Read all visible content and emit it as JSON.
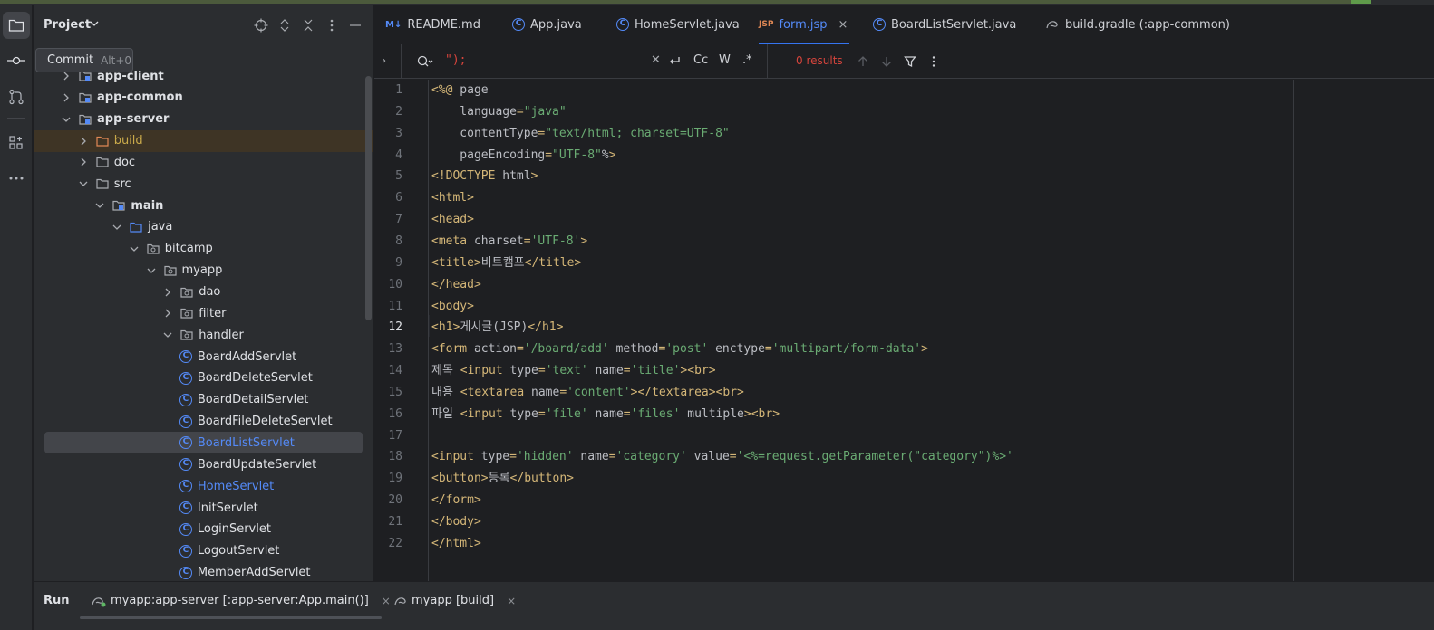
{
  "colors": {
    "accent": "#3574f0",
    "tag": "#d5b778",
    "string": "#6aab73",
    "search_no_results": "#d5443c",
    "class_icon": "#548af7"
  },
  "project_panel": {
    "title": "Project",
    "tooltip": {
      "label": "Commit",
      "shortcut": "Alt+0"
    },
    "tree": [
      {
        "label": "app-client",
        "depth": 1,
        "type": "module",
        "expanded": false
      },
      {
        "label": "app-common",
        "depth": 1,
        "type": "module",
        "expanded": false
      },
      {
        "label": "app-server",
        "depth": 1,
        "type": "module",
        "expanded": true
      },
      {
        "label": "build",
        "depth": 2,
        "type": "folder-excluded",
        "expanded": false
      },
      {
        "label": "doc",
        "depth": 2,
        "type": "folder",
        "expanded": false
      },
      {
        "label": "src",
        "depth": 2,
        "type": "folder",
        "expanded": true
      },
      {
        "label": "main",
        "depth": 3,
        "type": "folder-source",
        "expanded": true
      },
      {
        "label": "java",
        "depth": 4,
        "type": "folder-java",
        "expanded": true
      },
      {
        "label": "bitcamp",
        "depth": 5,
        "type": "package",
        "expanded": true
      },
      {
        "label": "myapp",
        "depth": 6,
        "type": "package",
        "expanded": true
      },
      {
        "label": "dao",
        "depth": 7,
        "type": "package",
        "expanded": false
      },
      {
        "label": "filter",
        "depth": 7,
        "type": "package",
        "expanded": false
      },
      {
        "label": "handler",
        "depth": 7,
        "type": "package",
        "expanded": true
      },
      {
        "label": "BoardAddServlet",
        "depth": 8,
        "type": "class"
      },
      {
        "label": "BoardDeleteServlet",
        "depth": 8,
        "type": "class"
      },
      {
        "label": "BoardDetailServlet",
        "depth": 8,
        "type": "class"
      },
      {
        "label": "BoardFileDeleteServlet",
        "depth": 8,
        "type": "class"
      },
      {
        "label": "BoardListServlet",
        "depth": 8,
        "type": "class",
        "selected": true
      },
      {
        "label": "BoardUpdateServlet",
        "depth": 8,
        "type": "class"
      },
      {
        "label": "HomeServlet",
        "depth": 8,
        "type": "class",
        "open": true
      },
      {
        "label": "InitServlet",
        "depth": 8,
        "type": "class"
      },
      {
        "label": "LoginServlet",
        "depth": 8,
        "type": "class"
      },
      {
        "label": "LogoutServlet",
        "depth": 8,
        "type": "class"
      },
      {
        "label": "MemberAddServlet",
        "depth": 8,
        "type": "class"
      }
    ]
  },
  "editor_tabs": [
    {
      "label": "README.md",
      "icon": "M↓"
    },
    {
      "label": "App.java",
      "icon": "class-icon"
    },
    {
      "label": "HomeServlet.java",
      "icon": "class-icon"
    },
    {
      "label": "form.jsp",
      "icon": "JSP",
      "active": true,
      "close": "×"
    },
    {
      "label": "BoardListServlet.java",
      "icon": "class-icon"
    },
    {
      "label": "build.gradle (:app-common)",
      "icon": "gradle-icon"
    }
  ],
  "search": {
    "query": "\");",
    "results": "0 results",
    "options": [
      "Cc",
      "W",
      ".*"
    ]
  },
  "editor": {
    "current_line": 12,
    "lines": [
      "<%@ page",
      "    language=\"java\"",
      "    contentType=\"text/html; charset=UTF-8\"",
      "    pageEncoding=\"UTF-8\"%>",
      "<!DOCTYPE html>",
      "<html>",
      "<head>",
      "<meta charset='UTF-8'>",
      "<title>비트캠프</title>",
      "</head>",
      "<body>",
      "<h1>게시글(JSP)</h1>",
      "<form action='/board/add' method='post' enctype='multipart/form-data'>",
      "제목 <input type='text' name='title'><br>",
      "내용 <textarea name='content'></textarea><br>",
      "파일 <input type='file' name='files' multiple><br>",
      "",
      "<input type='hidden' name='category' value='<%=request.getParameter(\"category\")%>'",
      "<button>등록</button>",
      "</form>",
      "</body>",
      "</html>"
    ]
  },
  "run_panel": {
    "title": "Run",
    "tabs": [
      {
        "label": "myapp:app-server [:app-server:App.main()]",
        "close": "×"
      },
      {
        "label": "myapp [build]",
        "close": "×"
      }
    ]
  }
}
